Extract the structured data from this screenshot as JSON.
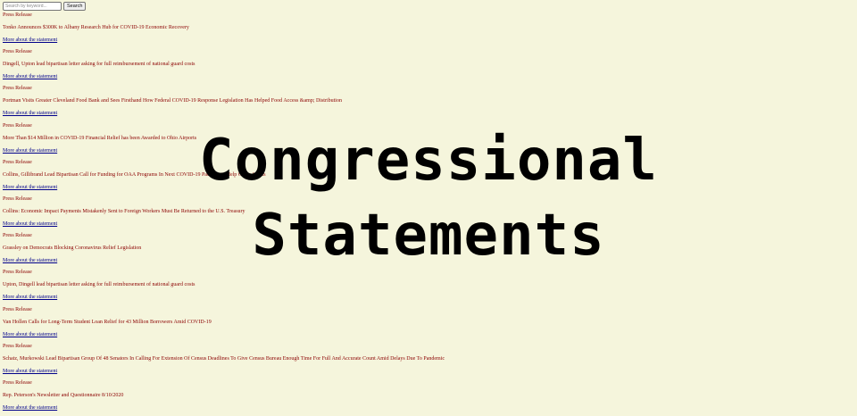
{
  "search": {
    "placeholder": "Search by keyword...",
    "button_label": "Search"
  },
  "statements": [
    {
      "kind": "Press Release",
      "title": "Tonko Announces $300K to Albany Research Hub for COVID-19 Economic Recovery",
      "link": "More about the statement"
    },
    {
      "kind": "Press Release",
      "title": "Dingell, Upton lead bipartisan letter asking for full reimbursement of national guard costs",
      "link": "More about the statement"
    },
    {
      "kind": "Press Release",
      "title": "Portman Visits Greater Cleveland Food Bank and Sees Firsthand How Federal COVID-19 Response Legislation Has Helped Food Access &amp; Distribution",
      "link": "More about the statement"
    },
    {
      "kind": "Press Release",
      "title": "More Than $14 Million in COVID-19 Financial Relief has been Awarded to Ohio Airports",
      "link": "More about the statement"
    },
    {
      "kind": "Press Release",
      "title": "Collins, Gillibrand Lead Bipartisan Call for Funding for OAA Programs In Next COVID-19 Package to Help Older Adults",
      "link": "More about the statement"
    },
    {
      "kind": "Press Release",
      "title": "Collins: Economic Impact Payments Mistakenly Sent to Foreign Workers Must Be Returned to the U.S. Treasury",
      "link": "More about the statement"
    },
    {
      "kind": "Press Release",
      "title": "Grassley on Democrats Blocking Coronavirus Relief Legislation",
      "link": "More about the statement"
    },
    {
      "kind": "Press Release",
      "title": "Upton, Dingell lead bipartisan letter asking for full reimbursement of national guard costs",
      "link": "More about the statement"
    },
    {
      "kind": "Press Release",
      "title": "Van Hollen Calls for Long-Term Student Loan Relief for 43 Million Borrowers Amid COVID-19",
      "link": "More about the statement"
    },
    {
      "kind": "Press Release",
      "title": "Schatz, Murkowski Lead Bipartisan Group Of 48 Senators In Calling For Extension Of Census Deadlines To Give Census Bureau Enough Time For Full And Accurate Count Amid Delays Due To Pandemic",
      "link": "More about the statement"
    },
    {
      "kind": "Press Release",
      "title": "Rep. Peterson's Newsletter and Questionnaire 8/10/2020",
      "link": "More about the statement"
    }
  ],
  "overlay": {
    "line1": "Congressional",
    "line2": "Statements"
  }
}
